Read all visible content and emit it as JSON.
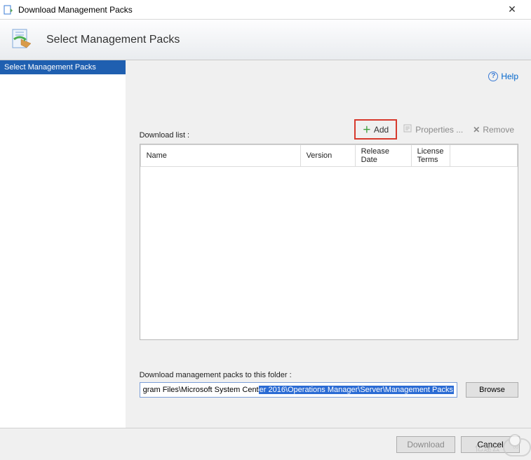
{
  "window": {
    "title": "Download Management Packs",
    "close_glyph": "✕"
  },
  "banner": {
    "heading": "Select Management Packs"
  },
  "sidebar": {
    "steps": [
      {
        "label": "Select Management Packs",
        "active": true
      }
    ]
  },
  "help": {
    "label": "Help",
    "glyph": "?"
  },
  "toolbar": {
    "list_label": "Download list :",
    "add_label": "Add",
    "properties_label": "Properties ...",
    "remove_label": "Remove"
  },
  "table": {
    "columns": [
      "Name",
      "Version",
      "Release Date",
      "License Terms"
    ],
    "rows": []
  },
  "destination": {
    "label": "Download management packs to this folder :",
    "path_prefix": "gram Files\\Microsoft System Cent",
    "path_selected": "er 2016\\Operations Manager\\Server\\Management Packs",
    "browse_label": "Browse"
  },
  "footer": {
    "download_label": "Download",
    "cancel_label": "Cancel"
  },
  "watermark": {
    "text": "亿速云"
  }
}
